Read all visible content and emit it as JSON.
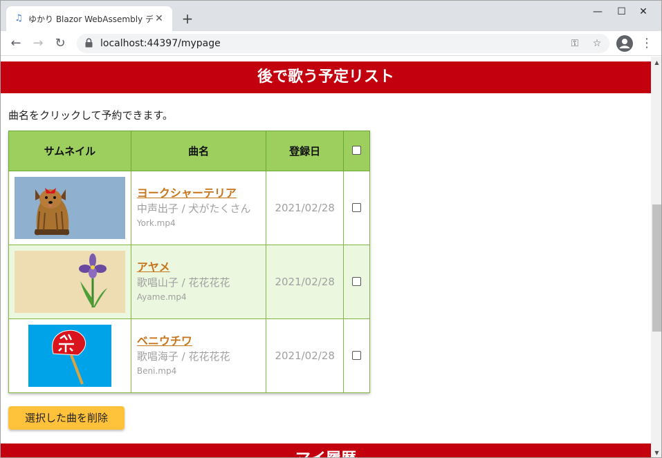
{
  "browser": {
    "tab_title": "ゆかり Blazor WebAssembly デモ",
    "tab_close": "✕",
    "new_tab": "+",
    "url": "localhost:44397/mypage",
    "window_controls": {
      "minimize": "—",
      "maximize": "☐",
      "close": "✕"
    }
  },
  "page": {
    "section_title": "後で歌う予定リスト",
    "intro": "曲名をクリックして予約できます。",
    "table": {
      "headers": {
        "thumbnail": "サムネイル",
        "song": "曲名",
        "date": "登録日"
      },
      "rows": [
        {
          "title": "ヨークシャーテリア",
          "artist": "中声出子 / 犬がたくさん",
          "file": "York.mp4",
          "date": "2021/02/28",
          "thumb_bg": "#8fb0cf",
          "icon": "yorkshire-terrier-thumbnail"
        },
        {
          "title": "アヤメ",
          "artist": "歌唱山子 / 花花花花",
          "file": "Ayame.mp4",
          "date": "2021/02/28",
          "thumb_bg": "#eedcb2",
          "icon": "iris-flower-thumbnail"
        },
        {
          "title": "ベニウチワ",
          "artist": "歌唱海子 / 花花花花",
          "file": "Beni.mp4",
          "date": "2021/02/28",
          "thumb_bg": "#00a3e8",
          "icon": "festival-fan-thumbnail"
        }
      ]
    },
    "delete_button": "選択した曲を削除",
    "next_section_title": "マイ履歴"
  },
  "colors": {
    "banner": "#c2000e",
    "header": "#9ccf5e",
    "alt_row": "#ebf7df",
    "button": "#ffc23a",
    "link": "#c8741a"
  }
}
